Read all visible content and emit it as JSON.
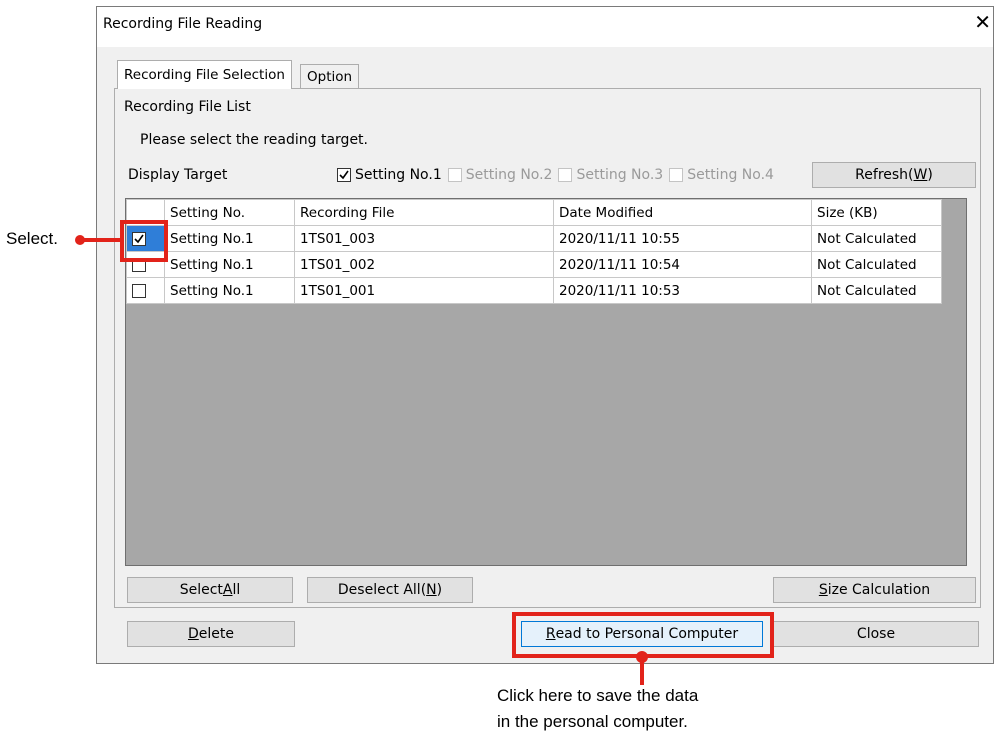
{
  "dialog": {
    "title": "Recording File Reading",
    "close_glyph": "✕"
  },
  "tabs": [
    {
      "label": "Recording File Selection",
      "active": true
    },
    {
      "label": "Option",
      "active": false
    }
  ],
  "panel": {
    "group_label": "Recording File List",
    "instruction": "Please select the reading target.",
    "display_target_label": "Display Target",
    "settings": [
      {
        "label": "Setting No.1",
        "checked": true,
        "enabled": true
      },
      {
        "label": "Setting No.2",
        "checked": false,
        "enabled": false
      },
      {
        "label": "Setting No.3",
        "checked": false,
        "enabled": false
      },
      {
        "label": "Setting No.4",
        "checked": false,
        "enabled": false
      }
    ],
    "refresh": {
      "label": "Refresh(",
      "mnemonic": "W",
      "suffix": ")"
    }
  },
  "table": {
    "columns": [
      "",
      "Setting No.",
      "Recording File",
      "Date Modified",
      "Size (KB)"
    ],
    "rows": [
      {
        "checked": true,
        "setting": "Setting No.1",
        "file": "1TS01_003",
        "date": "2020/11/11 10:55",
        "size": "Not Calculated"
      },
      {
        "checked": false,
        "setting": "Setting No.1",
        "file": "1TS01_002",
        "date": "2020/11/11 10:54",
        "size": "Not Calculated"
      },
      {
        "checked": false,
        "setting": "Setting No.1",
        "file": "1TS01_001",
        "date": "2020/11/11 10:53",
        "size": "Not Calculated"
      }
    ]
  },
  "buttons": {
    "select_all": {
      "label": "Select ",
      "mnemonic": "A",
      "suffix": "ll"
    },
    "deselect_all": {
      "label": "Deselect All(",
      "mnemonic": "N",
      "suffix": ")"
    },
    "size_calc": {
      "label": "",
      "mnemonic": "S",
      "suffix": "ize Calculation"
    },
    "delete": {
      "label": "",
      "mnemonic": "D",
      "suffix": "elete"
    },
    "read_pc": {
      "label": "",
      "mnemonic": "R",
      "suffix": "ead to Personal Computer"
    },
    "close": {
      "label": "Close"
    }
  },
  "annotations": {
    "select": "Select.",
    "read_line1": "Click here to save the data",
    "read_line2": "in the personal computer.",
    "highlight_color": "#e2231a"
  }
}
